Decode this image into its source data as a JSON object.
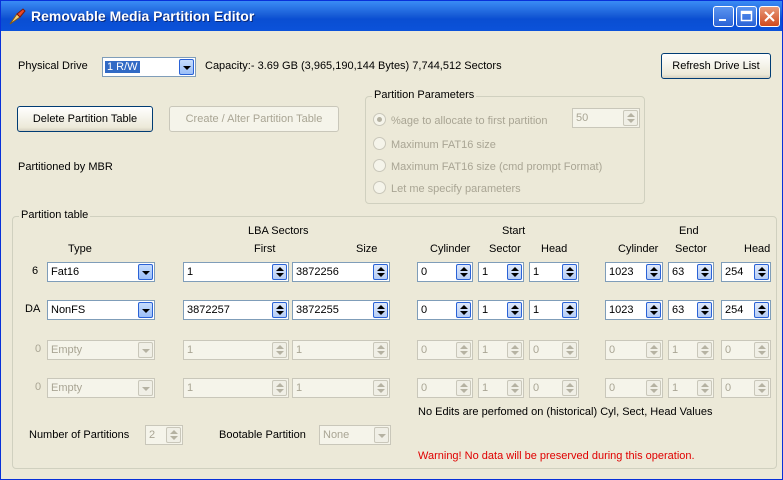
{
  "window": {
    "title": "Removable Media Partition Editor"
  },
  "drive": {
    "label": "Physical Drive",
    "selected": "1 R/W",
    "capacity": "Capacity:- 3.69 GB (3,965,190,144 Bytes) 7,744,512 Sectors",
    "refresh": "Refresh Drive List"
  },
  "actions": {
    "delete": "Delete Partition Table",
    "create": "Create / Alter Partition Table"
  },
  "status": "Partitioned by MBR",
  "params": {
    "title": "Partition Parameters",
    "opt1": "%age to allocate to first partition",
    "opt1_value": "50",
    "opt2": "Maximum FAT16 size",
    "opt3": "Maximum FAT16 size (cmd prompt Format)",
    "opt4": "Let me specify parameters"
  },
  "table": {
    "title": "Partition table",
    "headers": {
      "lba": "LBA Sectors",
      "start": "Start",
      "end": "End",
      "type": "Type",
      "first": "First",
      "size": "Size",
      "cyl": "Cylinder",
      "sector": "Sector",
      "head": "Head"
    },
    "rows": [
      {
        "id": "6",
        "type": "Fat16",
        "first": "1",
        "size": "3872256",
        "scyl": "0",
        "ssec": "1",
        "shead": "1",
        "ecyl": "1023",
        "esec": "63",
        "ehead": "254"
      },
      {
        "id": "DA",
        "type": "NonFS",
        "first": "3872257",
        "size": "3872255",
        "scyl": "0",
        "ssec": "1",
        "shead": "1",
        "ecyl": "1023",
        "esec": "63",
        "ehead": "254"
      },
      {
        "id": "0",
        "type": "Empty",
        "first": "1",
        "size": "1",
        "scyl": "0",
        "ssec": "1",
        "shead": "0",
        "ecyl": "0",
        "esec": "1",
        "ehead": "0"
      },
      {
        "id": "0",
        "type": "Empty",
        "first": "1",
        "size": "1",
        "scyl": "0",
        "ssec": "1",
        "shead": "0",
        "ecyl": "0",
        "esec": "1",
        "ehead": "0"
      }
    ],
    "note": "No Edits are perfomed on (historical) Cyl, Sect, Head Values",
    "num_label": "Number of Partitions",
    "num_value": "2",
    "boot_label": "Bootable Partition",
    "boot_value": "None",
    "warning": "Warning! No data will be preserved during this operation."
  }
}
